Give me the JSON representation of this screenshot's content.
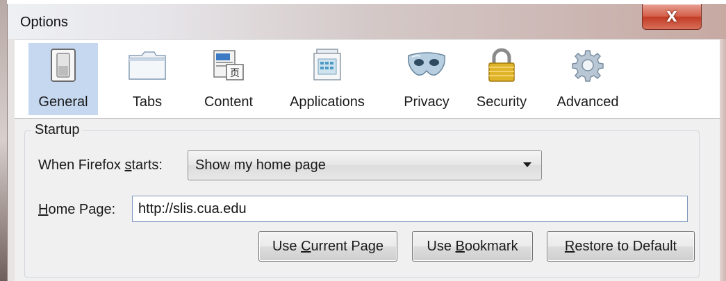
{
  "window": {
    "title": "Options",
    "close_glyph": "X"
  },
  "panes": [
    {
      "label": "General",
      "icon": "switch-icon",
      "selected": true
    },
    {
      "label": "Tabs",
      "icon": "tabs-folder-icon",
      "selected": false
    },
    {
      "label": "Content",
      "icon": "content-page-icon",
      "selected": false
    },
    {
      "label": "Applications",
      "icon": "applications-window-icon",
      "selected": false
    },
    {
      "label": "Privacy",
      "icon": "mask-icon",
      "selected": false
    },
    {
      "label": "Security",
      "icon": "padlock-icon",
      "selected": false
    },
    {
      "label": "Advanced",
      "icon": "gear-icon",
      "selected": false
    }
  ],
  "startup": {
    "legend": "Startup",
    "starts_label_pre": "When Firefox ",
    "starts_label_key": "s",
    "starts_label_post": "tarts:",
    "starts_value": "Show my home page",
    "home_label_key": "H",
    "home_label_post": "ome Page:",
    "home_value": "http://slis.cua.edu",
    "btn_current_pre": "Use ",
    "btn_current_key": "C",
    "btn_current_post": "urrent Page",
    "btn_bookmark_pre": "Use ",
    "btn_bookmark_key": "B",
    "btn_bookmark_post": "ookmark",
    "btn_restore_key": "R",
    "btn_restore_post": "estore to Default"
  },
  "colors": {
    "selected_pane": "#c5d8ef",
    "close_button": "#c94a33",
    "input_border": "#7d96bf"
  }
}
